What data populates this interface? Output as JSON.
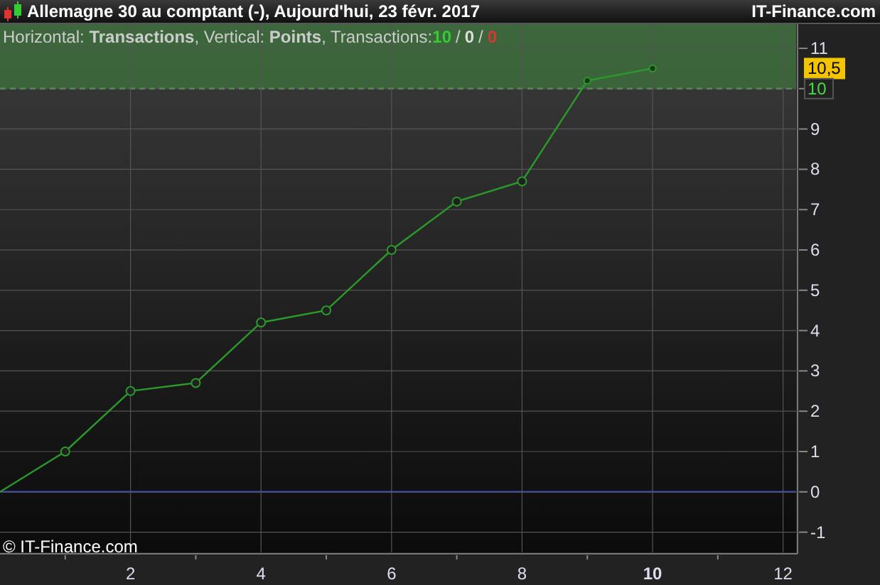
{
  "title_bar": {
    "title": "Allemagne 30 au comptant (-), Aujourd'hui, 23 févr. 2017",
    "brand": "IT-Finance.com"
  },
  "info_line": {
    "before": "Horizontal: **Transactions**, Vertical: ",
    "after": ", Transactions: ",
    "separator": "/",
    "counts": [
      {
        "value": "10",
        "color": "#33cc33"
      },
      {
        "value": "0",
        "color": "#dddddd"
      },
      {
        "value": "0",
        "color": "#dd3333"
      }
    ]
  },
  "price_tags": [
    {
      "kind": "current",
      "value": "10,5"
    },
    {
      "kind": "level",
      "value": "10"
    }
  ],
  "copyright": "© IT-Finance.com",
  "chart_data": {
    "type": "line",
    "x": [
      0,
      1,
      2,
      3,
      4,
      5,
      6,
      7,
      8,
      9,
      10
    ],
    "grid": true,
    "series": [
      {
        "name": "Points",
        "color": "#2a9a2a",
        "marker": "circle",
        "values": [
          0,
          1,
          2.5,
          2.7,
          4.2,
          4.5,
          6,
          7.2,
          7.7,
          10.2,
          10.5
        ]
      }
    ],
    "xlim": [
      0,
      12.2
    ],
    "ylim": [
      -1.5,
      11.6
    ],
    "xticks": [
      2,
      4,
      6,
      8,
      10,
      12
    ],
    "yticks": [
      -1,
      0,
      1,
      2,
      3,
      4,
      5,
      6,
      7,
      8,
      9,
      10,
      11
    ]
  }
}
